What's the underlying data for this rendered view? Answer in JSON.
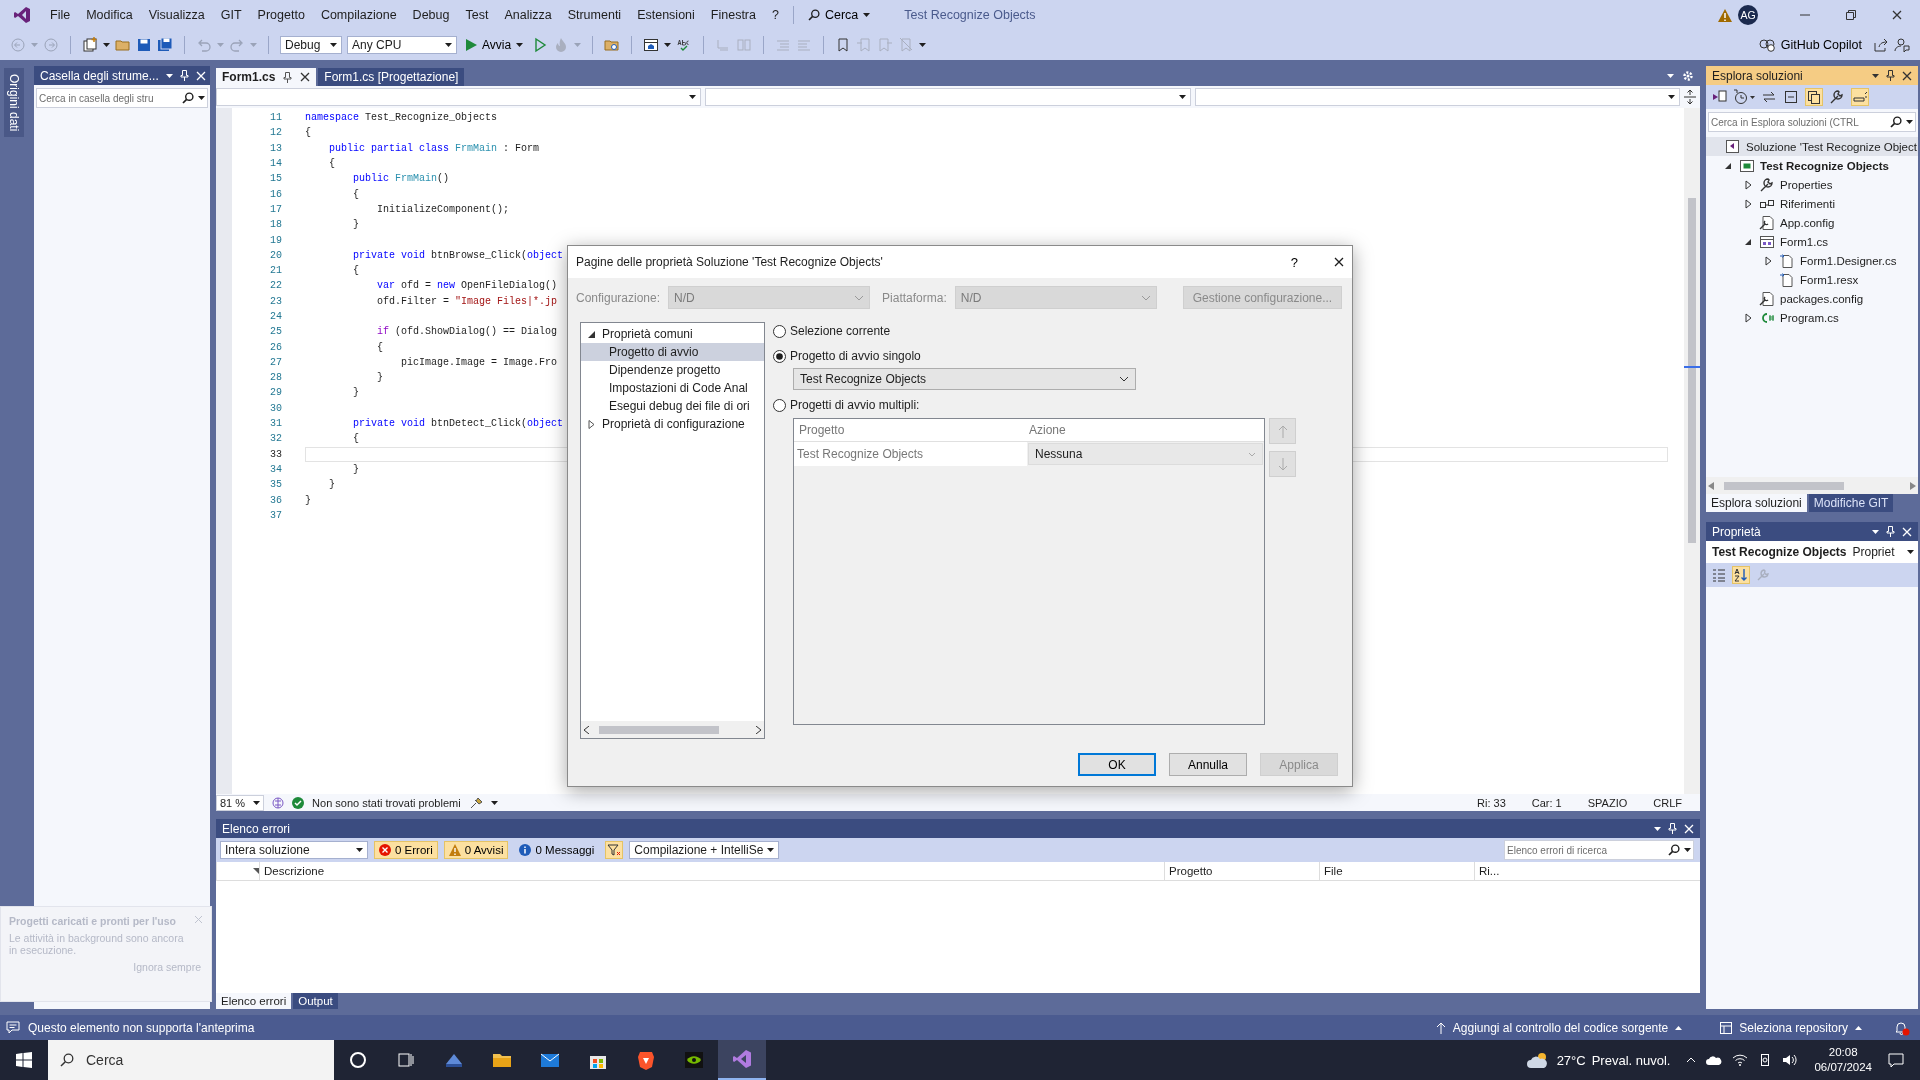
{
  "window": {
    "title": "Test Recognize Objects"
  },
  "menu": [
    "File",
    "Modifica",
    "Visualizza",
    "GIT",
    "Progetto",
    "Compilazione",
    "Debug",
    "Test",
    "Analizza",
    "Strumenti",
    "Estensioni",
    "Finestra",
    "?"
  ],
  "search_menu": {
    "label": "Cerca"
  },
  "account": {
    "initials": "AG"
  },
  "toolbar": {
    "configuration": "Debug",
    "platform": "Any CPU",
    "start": "Avvia",
    "copilot": "GitHub Copilot"
  },
  "side_strip": {
    "tab": "Origini dati"
  },
  "toolbox": {
    "title": "Casella degli strume...",
    "search": {
      "placeholder": "Cerca in casella degli stru"
    }
  },
  "editor": {
    "tabs": [
      {
        "label": "Form1.cs",
        "selected": true
      },
      {
        "label": "Form1.cs [Progettazione]",
        "selected": false
      }
    ],
    "lines": [
      {
        "number": "11",
        "current": false,
        "tokens": [
          {
            "kind": "keyword",
            "text": "namespace"
          },
          {
            "kind": "plain",
            "text": " Test_Recognize_Objects"
          }
        ]
      },
      {
        "number": "12",
        "current": false,
        "tokens": [
          {
            "kind": "plain",
            "text": "{"
          }
        ]
      },
      {
        "number": "13",
        "current": false,
        "tokens": [
          {
            "kind": "keyword",
            "text": "    public"
          },
          {
            "kind": "keyword",
            "text": " partial"
          },
          {
            "kind": "keyword",
            "text": " class"
          },
          {
            "kind": "type",
            "text": " FrmMain"
          },
          {
            "kind": "plain",
            "text": " : Form"
          }
        ]
      },
      {
        "number": "14",
        "current": false,
        "tokens": [
          {
            "kind": "plain",
            "text": "    {"
          }
        ]
      },
      {
        "number": "15",
        "current": false,
        "tokens": [
          {
            "kind": "keyword",
            "text": "        public"
          },
          {
            "kind": "type",
            "text": " FrmMain"
          },
          {
            "kind": "plain",
            "text": "()"
          }
        ]
      },
      {
        "number": "16",
        "current": false,
        "tokens": [
          {
            "kind": "plain",
            "text": "        {"
          }
        ]
      },
      {
        "number": "17",
        "current": false,
        "tokens": [
          {
            "kind": "plain",
            "text": "            InitializeComponent();"
          }
        ]
      },
      {
        "number": "18",
        "current": false,
        "tokens": [
          {
            "kind": "plain",
            "text": "        }"
          }
        ]
      },
      {
        "number": "19",
        "current": false
      },
      {
        "number": "20",
        "current": false,
        "tokens": [
          {
            "kind": "keyword",
            "text": "        private"
          },
          {
            "kind": "keyword",
            "text": " void"
          },
          {
            "kind": "plain",
            "text": " btnBrowse_Click("
          },
          {
            "kind": "keyword",
            "text": "object"
          }
        ]
      },
      {
        "number": "21",
        "current": false,
        "tokens": [
          {
            "kind": "plain",
            "text": "        {"
          }
        ]
      },
      {
        "number": "22",
        "current": false,
        "tokens": [
          {
            "kind": "keyword",
            "text": "            var"
          },
          {
            "kind": "plain",
            "text": " ofd = "
          },
          {
            "kind": "keyword",
            "text": "new"
          },
          {
            "kind": "plain",
            "text": " OpenFileDialog()"
          }
        ]
      },
      {
        "number": "23",
        "current": false,
        "tokens": [
          {
            "kind": "plain",
            "text": "            ofd.Filter = "
          },
          {
            "kind": "string",
            "text": "\"Image Files|*.jp"
          }
        ]
      },
      {
        "number": "24",
        "current": false
      },
      {
        "number": "25",
        "current": false,
        "tokens": [
          {
            "kind": "control",
            "text": "            if"
          },
          {
            "kind": "plain",
            "text": " (ofd.ShowDialog() == Dialog"
          }
        ]
      },
      {
        "number": "26",
        "current": false,
        "tokens": [
          {
            "kind": "plain",
            "text": "            {"
          }
        ]
      },
      {
        "number": "27",
        "current": false,
        "tokens": [
          {
            "kind": "plain",
            "text": "                picImage.Image = Image.Fro"
          }
        ]
      },
      {
        "number": "28",
        "current": false,
        "tokens": [
          {
            "kind": "plain",
            "text": "            }"
          }
        ]
      },
      {
        "number": "29",
        "current": false,
        "tokens": [
          {
            "kind": "plain",
            "text": "        }"
          }
        ]
      },
      {
        "number": "30",
        "current": false
      },
      {
        "number": "31",
        "current": false,
        "tokens": [
          {
            "kind": "keyword",
            "text": "        private"
          },
          {
            "kind": "keyword",
            "text": " void"
          },
          {
            "kind": "plain",
            "text": " btnDetect_Click("
          },
          {
            "kind": "keyword",
            "text": "object"
          }
        ]
      },
      {
        "number": "32",
        "current": false,
        "tokens": [
          {
            "kind": "plain",
            "text": "        {"
          }
        ]
      },
      {
        "number": "33",
        "current": true
      },
      {
        "number": "34",
        "current": false,
        "tokens": [
          {
            "kind": "plain",
            "text": "        }"
          }
        ]
      },
      {
        "number": "35",
        "current": false,
        "tokens": [
          {
            "kind": "plain",
            "text": "    }"
          }
        ]
      },
      {
        "number": "36",
        "current": false,
        "tokens": [
          {
            "kind": "plain",
            "text": "}"
          }
        ]
      },
      {
        "number": "37",
        "current": false
      }
    ],
    "status": {
      "zoom": "81 %",
      "issues": "Non sono stati trovati problemi",
      "line": "Ri: 33",
      "column": "Car: 1",
      "whitespace": "SPAZIO",
      "line_endings": "CRLF"
    }
  },
  "dialog": {
    "title": "Pagine delle proprietà Soluzione 'Test Recognize Objects'",
    "help": "?",
    "configuration": {
      "label": "Configurazione:",
      "value": "N/D"
    },
    "platform": {
      "label": "Piattaforma:",
      "value": "N/D"
    },
    "manage_button": "Gestione configurazione...",
    "tree": [
      {
        "label": "Proprietà comuni",
        "expanded": true,
        "selected": false,
        "children": [
          {
            "label": "Progetto di avvio",
            "selected": true
          },
          {
            "label": "Dipendenze progetto",
            "selected": false
          },
          {
            "label": "Impostazioni di Code Anal",
            "selected": false
          },
          {
            "label": "Esegui debug dei file di ori",
            "selected": false
          }
        ]
      },
      {
        "label": "Proprietà di configurazione",
        "expanded": false,
        "selected": false
      }
    ],
    "startup_options": [
      {
        "label": "Selezione corrente",
        "selected": false
      },
      {
        "label": "Progetto di avvio singolo",
        "selected": true
      },
      {
        "label": "Progetti di avvio multipli:",
        "selected": false
      }
    ],
    "single_project": "Test Recognize Objects",
    "grid": {
      "columns": [
        "Progetto",
        "Azione"
      ],
      "rows": [
        {
          "project": "Test Recognize Objects",
          "action": "Nessuna"
        }
      ]
    },
    "buttons": [
      {
        "label": "OK",
        "kind": "default"
      },
      {
        "label": "Annulla",
        "kind": "normal"
      },
      {
        "label": "Applica",
        "kind": "disabled"
      }
    ]
  },
  "solution_explorer": {
    "title": "Esplora soluzioni",
    "search": {
      "placeholder": "Cerca in Esplora soluzioni (CTRL"
    },
    "tree": [
      {
        "label": "Soluzione 'Test Recognize Object",
        "kind": "solution",
        "selected": true,
        "children": [
          {
            "label": "Test Recognize Objects",
            "kind": "project",
            "expanded": true,
            "selected": false,
            "children": [
              {
                "label": "Properties",
                "kind": "properties",
                "expanded": false,
                "selected": false
              },
              {
                "label": "Riferimenti",
                "kind": "references",
                "expanded": false,
                "selected": false
              },
              {
                "label": "App.config",
                "kind": "config",
                "selected": false
              },
              {
                "label": "Form1.cs",
                "kind": "form",
                "expanded": true,
                "selected": false,
                "children": [
                  {
                    "label": "Form1.Designer.cs",
                    "kind": "file",
                    "expanded": false,
                    "selected": false
                  },
                  {
                    "label": "Form1.resx",
                    "kind": "file",
                    "selected": false
                  }
                ]
              },
              {
                "label": "packages.config",
                "kind": "config",
                "selected": false
              },
              {
                "label": "Program.cs",
                "kind": "csharp",
                "expanded": false,
                "selected": false
              }
            ]
          }
        ]
      }
    ],
    "tabs": [
      {
        "label": "Esplora soluzioni",
        "selected": true
      },
      {
        "label": "Modifiche GIT",
        "selected": false
      }
    ]
  },
  "properties": {
    "title": "Proprietà",
    "object": "Test Recognize Objects",
    "object_type": "Propriet"
  },
  "error_list": {
    "title": "Elenco errori",
    "scope": "Intera soluzione",
    "filters": [
      {
        "kind": "error",
        "label": "0 Errori",
        "on": true
      },
      {
        "kind": "warning",
        "label": "0 Avvisi",
        "on": true
      },
      {
        "kind": "info",
        "label": "0 Messaggi",
        "on": false
      }
    ],
    "source": "Compilazione + IntelliSe",
    "search": {
      "placeholder": "Elenco errori di ricerca"
    },
    "columns": [
      "Descrizione",
      "Progetto",
      "File",
      "Ri..."
    ]
  },
  "bottom_tabs": [
    {
      "label": "Elenco errori",
      "selected": true
    },
    {
      "label": "Output",
      "selected": false
    }
  ],
  "notification": {
    "title": "Progetti caricati e pronti per l'uso",
    "message": "Le attività in background sono ancora in esecuzione.",
    "action": "Ignora sempre"
  },
  "status_bar": {
    "message": "Questo elemento non supporta l'anteprima",
    "source_control": "Aggiungi al controllo del codice sorgente",
    "repository": "Seleziona repository"
  },
  "taskbar": {
    "search": {
      "placeholder": "Cerca"
    },
    "temperature": "27°C",
    "forecast": "Preval. nuvol.",
    "time": "20:08",
    "date": "06/07/2024"
  }
}
